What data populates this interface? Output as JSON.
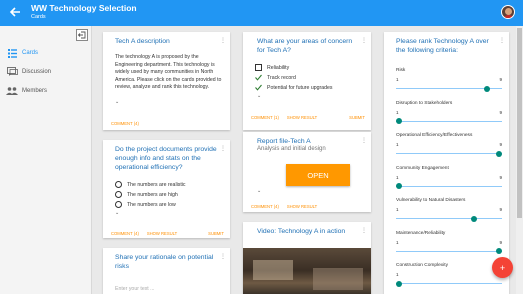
{
  "header": {
    "title": "WW Technology Selection",
    "subtitle": "Cards",
    "accent": "#2196f3"
  },
  "sidebar": {
    "items": [
      {
        "label": "Cards",
        "icon": "cards-icon",
        "active": true
      },
      {
        "label": "Discussion",
        "icon": "discussion-icon",
        "active": false
      },
      {
        "label": "Members",
        "icon": "members-icon",
        "active": false
      }
    ]
  },
  "cards": {
    "description": {
      "title": "Tech A description",
      "body": "The technology A is proposed by the Engineering department. This technology is widely used by many communities in North America. Please click on the cards provided to review, analyze and rank this technology.",
      "comment": "COMMENT (4)"
    },
    "concern": {
      "title": "What are your areas of concern for Tech A?",
      "options": [
        {
          "label": "Reliability",
          "checked": false
        },
        {
          "label": "Track record",
          "checked": true
        },
        {
          "label": "Potential for future upgrades",
          "checked": true
        }
      ],
      "comment": "COMMENT (1)",
      "show_result": "SHOW RESULT",
      "submit": "SUBMIT"
    },
    "project_docs": {
      "title": "Do the project documents provide enough info and stats on the operational efficiency?",
      "options": [
        {
          "label": "The numbers are realistic"
        },
        {
          "label": "The numbers are high"
        },
        {
          "label": "The numbers are low"
        }
      ],
      "comment": "COMMENT (4)",
      "show_result": "SHOW RESULT",
      "submit": "SUBMIT"
    },
    "report": {
      "title": "Report file-Tech A",
      "subtitle": "Analysis and initial design",
      "open_label": "OPEN",
      "comment": "COMMENT (4)",
      "show_result": "SHOW RESULT"
    },
    "rationale": {
      "title": "Share your rationale on potential risks",
      "placeholder": "Enter your text ..."
    },
    "video": {
      "title": "Video: Technology A in action"
    },
    "ranking": {
      "title": "Please rank Technology A over the following criteria:",
      "min": "1",
      "max": "9",
      "criteria": [
        {
          "label": "Risk",
          "value": 8
        },
        {
          "label": "Disruption to Stakeholders",
          "value": 1
        },
        {
          "label": "Operational Efficiency/Effectiveness",
          "value": 9
        },
        {
          "label": "Community Engagement",
          "value": 1
        },
        {
          "label": "Vulnerability to Natural Disasters",
          "value": 7
        },
        {
          "label": "Maintenance/Reliability",
          "value": 9
        },
        {
          "label": "Construction Complexity",
          "value": 1
        }
      ]
    }
  },
  "fab": {
    "label": "+"
  }
}
